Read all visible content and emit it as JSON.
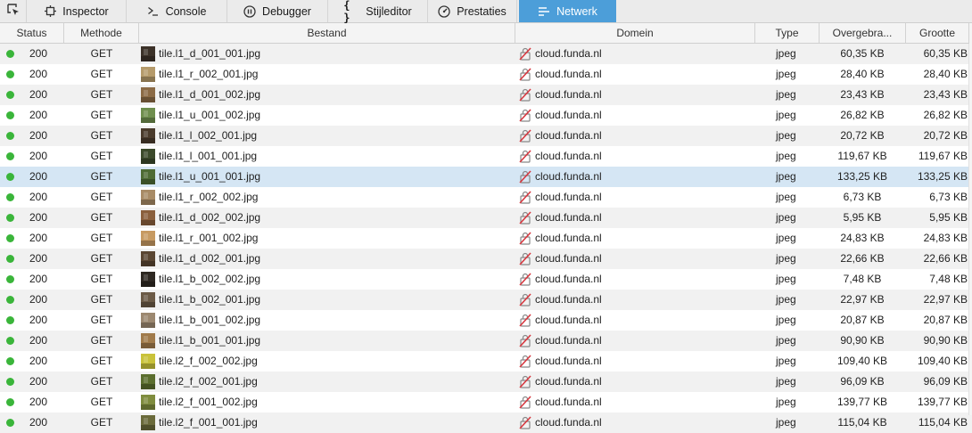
{
  "toolbar": {
    "picker_icon": "element-picker-icon",
    "tabs": [
      {
        "label": "Inspector",
        "icon": "inspector-icon",
        "selected": false
      },
      {
        "label": "Console",
        "icon": "console-icon",
        "selected": false
      },
      {
        "label": "Debugger",
        "icon": "debugger-icon",
        "selected": false
      },
      {
        "label": "Stijleditor",
        "icon": "style-editor-icon",
        "selected": false
      },
      {
        "label": "Prestaties",
        "icon": "performance-icon",
        "selected": false
      },
      {
        "label": "Netwerk",
        "icon": "network-icon",
        "selected": true
      }
    ]
  },
  "columns": {
    "status": "Status",
    "method": "Methode",
    "file": "Bestand",
    "domain": "Domein",
    "type": "Type",
    "transferred": "Overgebra...",
    "size": "Grootte"
  },
  "colors": {
    "accent": "#4c9ed9",
    "status_ok": "#3ab53a",
    "selected_row": "#d5e6f4",
    "stripe": "#f1f1f1"
  },
  "requests": [
    {
      "status": "200",
      "method": "GET",
      "file": "tile.l1_d_001_001.jpg",
      "domain": "cloud.funda.nl",
      "type": "jpeg",
      "transferred": "60,35 KB",
      "size": "60,35 KB",
      "thumb": "#3b3128"
    },
    {
      "status": "200",
      "method": "GET",
      "file": "tile.l1_r_002_001.jpg",
      "domain": "cloud.funda.nl",
      "type": "jpeg",
      "transferred": "28,40 KB",
      "size": "28,40 KB",
      "thumb": "#b59a6a"
    },
    {
      "status": "200",
      "method": "GET",
      "file": "tile.l1_d_001_002.jpg",
      "domain": "cloud.funda.nl",
      "type": "jpeg",
      "transferred": "23,43 KB",
      "size": "23,43 KB",
      "thumb": "#8b6a45"
    },
    {
      "status": "200",
      "method": "GET",
      "file": "tile.l1_u_001_002.jpg",
      "domain": "cloud.funda.nl",
      "type": "jpeg",
      "transferred": "26,82 KB",
      "size": "26,82 KB",
      "thumb": "#6f8e4e"
    },
    {
      "status": "200",
      "method": "GET",
      "file": "tile.l1_l_002_001.jpg",
      "domain": "cloud.funda.nl",
      "type": "jpeg",
      "transferred": "20,72 KB",
      "size": "20,72 KB",
      "thumb": "#4a3b2c"
    },
    {
      "status": "200",
      "method": "GET",
      "file": "tile.l1_l_001_001.jpg",
      "domain": "cloud.funda.nl",
      "type": "jpeg",
      "transferred": "119,67 KB",
      "size": "119,67 KB",
      "thumb": "#3c4a2b"
    },
    {
      "status": "200",
      "method": "GET",
      "file": "tile.l1_u_001_001.jpg",
      "domain": "cloud.funda.nl",
      "type": "jpeg",
      "transferred": "133,25 KB",
      "size": "133,25 KB",
      "thumb": "#4e6b34",
      "selected": true
    },
    {
      "status": "200",
      "method": "GET",
      "file": "tile.l1_r_002_002.jpg",
      "domain": "cloud.funda.nl",
      "type": "jpeg",
      "transferred": "6,73 KB",
      "size": "6,73 KB",
      "thumb": "#a88b66"
    },
    {
      "status": "200",
      "method": "GET",
      "file": "tile.l1_d_002_002.jpg",
      "domain": "cloud.funda.nl",
      "type": "jpeg",
      "transferred": "5,95 KB",
      "size": "5,95 KB",
      "thumb": "#8a5f3c"
    },
    {
      "status": "200",
      "method": "GET",
      "file": "tile.l1_r_001_002.jpg",
      "domain": "cloud.funda.nl",
      "type": "jpeg",
      "transferred": "24,83 KB",
      "size": "24,83 KB",
      "thumb": "#c79a62"
    },
    {
      "status": "200",
      "method": "GET",
      "file": "tile.l1_d_002_001.jpg",
      "domain": "cloud.funda.nl",
      "type": "jpeg",
      "transferred": "22,66 KB",
      "size": "22,66 KB",
      "thumb": "#5a4632"
    },
    {
      "status": "200",
      "method": "GET",
      "file": "tile.l1_b_002_002.jpg",
      "domain": "cloud.funda.nl",
      "type": "jpeg",
      "transferred": "7,48 KB",
      "size": "7,48 KB",
      "thumb": "#2e2822"
    },
    {
      "status": "200",
      "method": "GET",
      "file": "tile.l1_b_002_001.jpg",
      "domain": "cloud.funda.nl",
      "type": "jpeg",
      "transferred": "22,97 KB",
      "size": "22,97 KB",
      "thumb": "#6b5a46"
    },
    {
      "status": "200",
      "method": "GET",
      "file": "tile.l1_b_001_002.jpg",
      "domain": "cloud.funda.nl",
      "type": "jpeg",
      "transferred": "20,87 KB",
      "size": "20,87 KB",
      "thumb": "#9c8870"
    },
    {
      "status": "200",
      "method": "GET",
      "file": "tile.l1_b_001_001.jpg",
      "domain": "cloud.funda.nl",
      "type": "jpeg",
      "transferred": "90,90 KB",
      "size": "90,90 KB",
      "thumb": "#a07a4a"
    },
    {
      "status": "200",
      "method": "GET",
      "file": "tile.l2_f_002_002.jpg",
      "domain": "cloud.funda.nl",
      "type": "jpeg",
      "transferred": "109,40 KB",
      "size": "109,40 KB",
      "thumb": "#c9c23a"
    },
    {
      "status": "200",
      "method": "GET",
      "file": "tile.l2_f_002_001.jpg",
      "domain": "cloud.funda.nl",
      "type": "jpeg",
      "transferred": "96,09 KB",
      "size": "96,09 KB",
      "thumb": "#5b6e2e"
    },
    {
      "status": "200",
      "method": "GET",
      "file": "tile.l2_f_001_002.jpg",
      "domain": "cloud.funda.nl",
      "type": "jpeg",
      "transferred": "139,77 KB",
      "size": "139,77 KB",
      "thumb": "#7f8c3e"
    },
    {
      "status": "200",
      "method": "GET",
      "file": "tile.l2_f_001_001.jpg",
      "domain": "cloud.funda.nl",
      "type": "jpeg",
      "transferred": "115,04 KB",
      "size": "115,04 KB",
      "thumb": "#6a6a3a"
    }
  ]
}
